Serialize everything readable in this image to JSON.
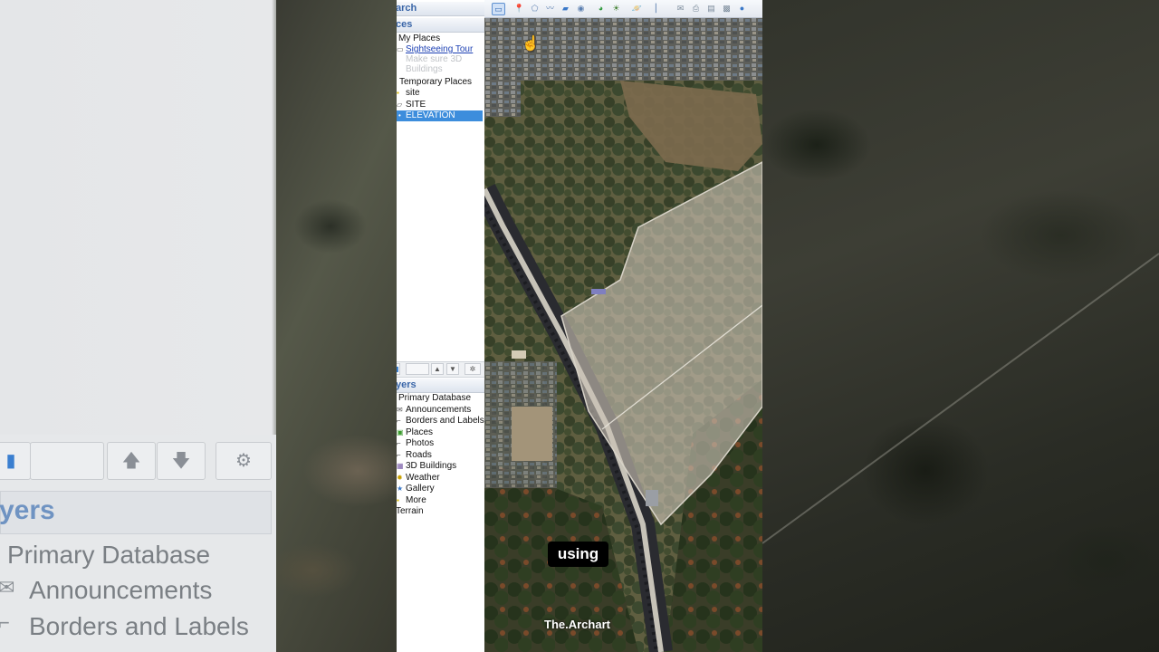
{
  "search_header": "arch",
  "places": {
    "header": "ces",
    "items": [
      {
        "label": "My Places",
        "style": "normal"
      },
      {
        "label": "Sightseeing Tour",
        "style": "link"
      },
      {
        "label": "Make sure 3D",
        "style": "grey"
      },
      {
        "label": "Buildings",
        "style": "grey"
      },
      {
        "label": "Temporary Places",
        "style": "normal"
      },
      {
        "label": "site",
        "style": "normal"
      },
      {
        "label": "SITE",
        "style": "normal"
      },
      {
        "label": "ELEVATION",
        "style": "selected"
      }
    ]
  },
  "layers": {
    "header": "yers",
    "items": [
      {
        "label": "Primary Database",
        "icon": "database-icon"
      },
      {
        "label": "Announcements",
        "icon": "mail-icon"
      },
      {
        "label": "Borders and Labels",
        "icon": "border-icon"
      },
      {
        "label": "Places",
        "icon": "places-icon"
      },
      {
        "label": "Photos",
        "icon": "photo-icon"
      },
      {
        "label": "Roads",
        "icon": "road-icon"
      },
      {
        "label": "3D Buildings",
        "icon": "building-icon"
      },
      {
        "label": "Weather",
        "icon": "sun-icon"
      },
      {
        "label": "Gallery",
        "icon": "star-icon"
      },
      {
        "label": "More",
        "icon": "folder-icon"
      },
      {
        "label": "Terrain",
        "icon": "terrain-icon"
      }
    ]
  },
  "zoomed_left": {
    "header": "yers",
    "items": [
      "Primary Database",
      "Announcements",
      "Borders and Labels"
    ]
  },
  "subtitle": "using",
  "watermark": "The.Archart",
  "colors": {
    "accent": "#3d8ddc",
    "header_text": "#3a66a8",
    "link": "#1b3fb3"
  }
}
